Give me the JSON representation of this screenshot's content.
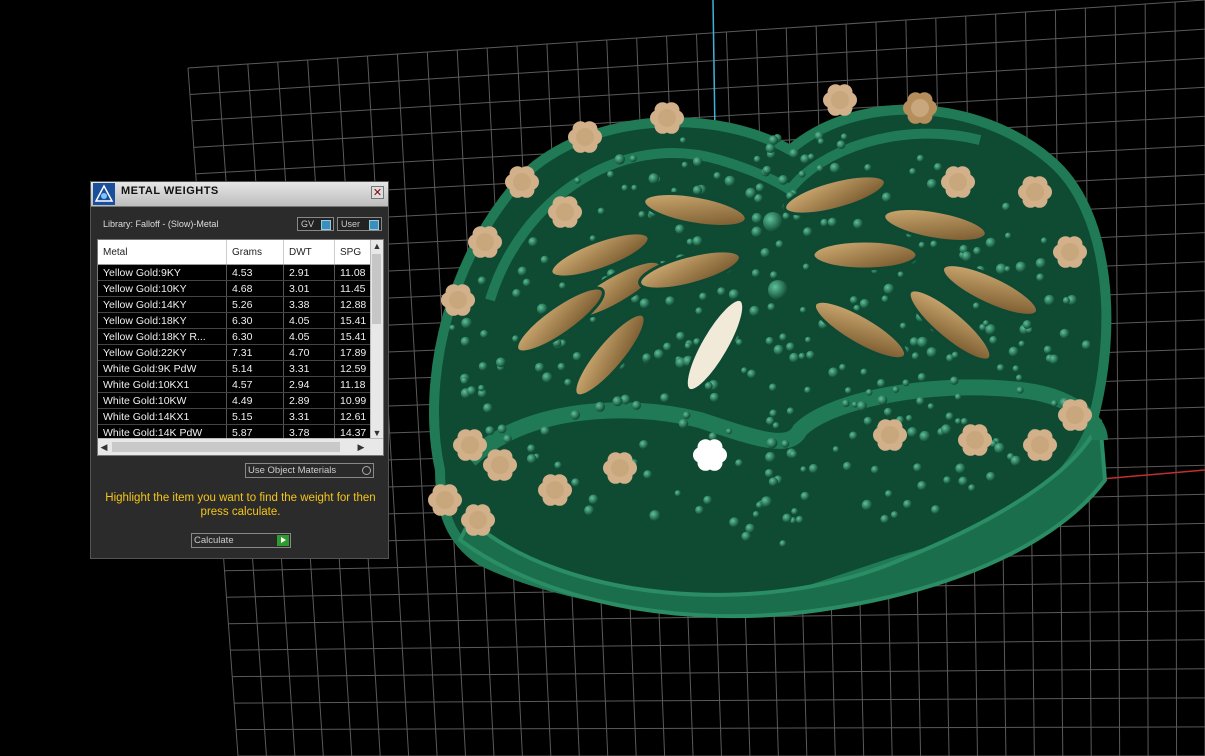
{
  "panel": {
    "title": "METAL WEIGHTS",
    "close_glyph": "✕",
    "library_label": "Library: Falloff - (Slow)-Metal",
    "toggles": {
      "gv": "GV",
      "user": "User"
    },
    "columns": [
      "Metal",
      "Grams",
      "DWT",
      "SPG"
    ],
    "rows": [
      [
        "Yellow Gold:9KY",
        "4.53",
        "2.91",
        "11.08"
      ],
      [
        "Yellow Gold:10KY",
        "4.68",
        "3.01",
        "11.45"
      ],
      [
        "Yellow Gold:14KY",
        "5.26",
        "3.38",
        "12.88"
      ],
      [
        "Yellow Gold:18KY",
        "6.30",
        "4.05",
        "15.41"
      ],
      [
        "Yellow Gold:18KY R...",
        "6.30",
        "4.05",
        "15.41"
      ],
      [
        "Yellow Gold:22KY",
        "7.31",
        "4.70",
        "17.89"
      ],
      [
        "White Gold:9K PdW",
        "5.14",
        "3.31",
        "12.59"
      ],
      [
        "White Gold:10KX1",
        "4.57",
        "2.94",
        "11.18"
      ],
      [
        "White Gold:10KW",
        "4.49",
        "2.89",
        "10.99"
      ],
      [
        "White Gold:14KX1",
        "5.15",
        "3.31",
        "12.61"
      ],
      [
        "White Gold:14K PdW",
        "5.87",
        "3.78",
        "14.37"
      ]
    ],
    "use_materials_label": "Use Object Materials",
    "hint_text": "Highlight the item you want to find the weight for then press calculate.",
    "calculate_label": "Calculate"
  },
  "colors": {
    "ring": "#1f7a55",
    "metal_gold": "#b08a56",
    "grid": "#5a5a5a",
    "hint": "#f5c518"
  },
  "icons": [
    "app-logo-icon",
    "close-icon",
    "toggle-icon",
    "radio-icon",
    "play-icon",
    "scroll-up-icon",
    "scroll-down-icon"
  ]
}
